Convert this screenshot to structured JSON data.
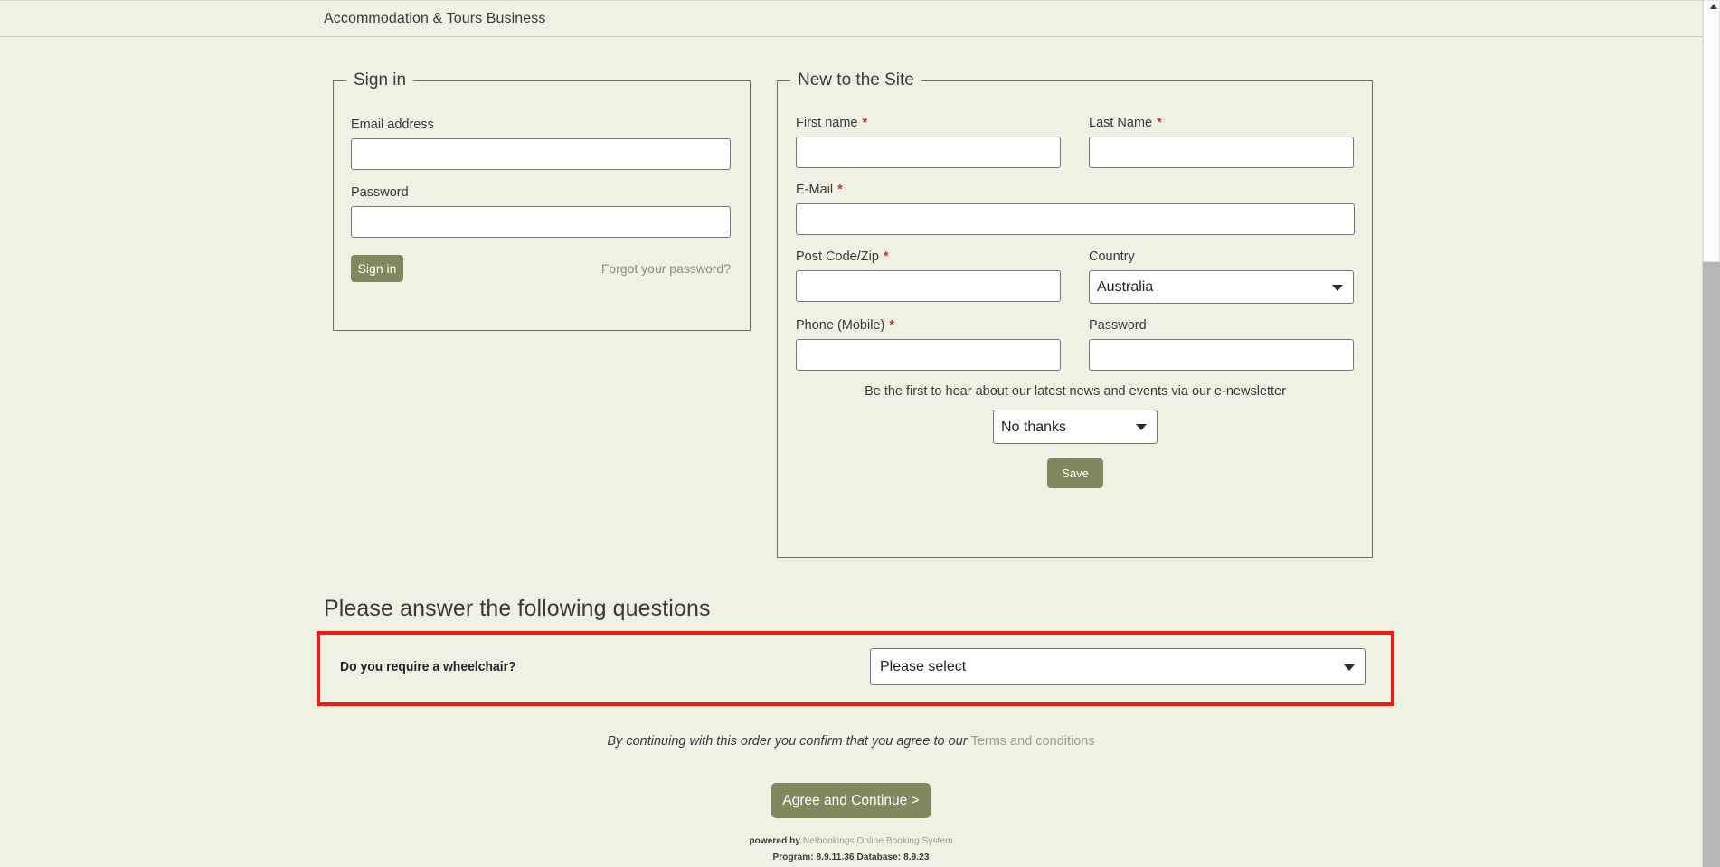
{
  "header": {
    "title": "Accommodation & Tours Business"
  },
  "signin": {
    "legend": "Sign in",
    "email_label": "Email address",
    "email_value": "",
    "email_placeholder": "",
    "password_label": "Password",
    "password_value": "",
    "password_placeholder": "",
    "submit_label": "Sign in",
    "forgot_label": "Forgot your password?"
  },
  "register": {
    "legend": "New to the Site",
    "first_name_label": "First name",
    "first_name_value": "",
    "last_name_label": "Last Name",
    "last_name_value": "",
    "email_label": "E-Mail",
    "email_value": "",
    "postcode_label": "Post Code/Zip",
    "postcode_value": "",
    "country_label": "Country",
    "country_value": "Australia",
    "country_options": [
      "Australia"
    ],
    "phone_label": "Phone (Mobile)",
    "phone_value": "",
    "password_label": "Password",
    "password_value": "",
    "required_marker": "*",
    "newsletter_note": "Be the first to hear about our latest news and events via our e-newsletter",
    "newsletter_value": "No thanks",
    "newsletter_options": [
      "No thanks"
    ],
    "save_label": "Save"
  },
  "questions": {
    "title": "Please answer the following questions",
    "items": [
      {
        "label": "Do you require a wheelchair?",
        "value": "Please select",
        "options": [
          "Please select"
        ]
      }
    ],
    "highlight_color": "#f01a16"
  },
  "terms": {
    "text": "By continuing with this order you confirm that you agree to our ",
    "link_label": "Terms and conditions"
  },
  "actions": {
    "continue_label": "Agree and Continue >"
  },
  "footer": {
    "powered_prefix": "powered by ",
    "powered_link": "Netbookings Online Booking System",
    "versions": "Program: 8.9.11.36 Database: 8.9.23"
  },
  "theme": {
    "background": "#f0f1e3",
    "accent_green": "#82875f",
    "border_olive": "#6f705c",
    "link_muted": "#9ba08a",
    "required_red": "#c0392b"
  }
}
